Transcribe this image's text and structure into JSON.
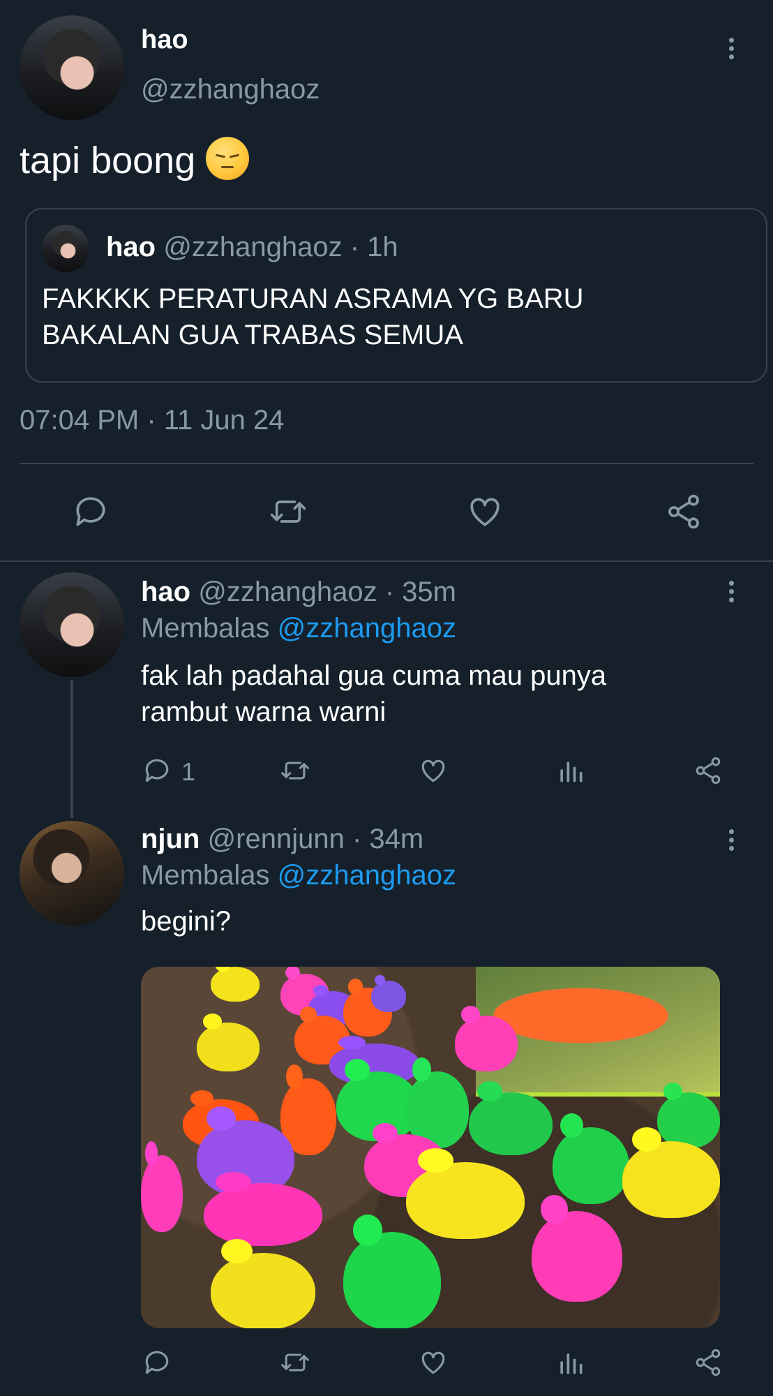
{
  "main_tweet": {
    "display_name": "hao",
    "handle": "@zzhanghaoz",
    "text": "tapi boong",
    "emoji": "pensive-face",
    "timestamp": "07:04 PM · 11 Jun 24"
  },
  "quoted_tweet": {
    "display_name": "hao",
    "handle": "@zzhanghaoz",
    "time": "· 1h",
    "text_line1": "FAKKKK PERATURAN ASRAMA YG BARU",
    "text_line2": "BAKALAN GUA TRABAS SEMUA"
  },
  "replies": [
    {
      "display_name": "hao",
      "handle": "@zzhanghaoz",
      "time": "· 35m",
      "replying_label": "Membalas",
      "replying_to": "@zzhanghaoz",
      "text_line1": "fak lah padahal gua cuma mau punya",
      "text_line2": "rambut warna warni",
      "reply_count": "1"
    },
    {
      "display_name": "njun",
      "handle": "@rennjunn",
      "time": "· 34m",
      "replying_label": "Membalas",
      "replying_to": "@zzhanghaoz",
      "text": "begini?",
      "reply_count": ""
    }
  ],
  "colors": {
    "background": "#15202b",
    "muted": "#8899a6",
    "link": "#1d9bf0",
    "divider": "#38444d"
  },
  "icons": [
    "reply-icon",
    "retweet-icon",
    "like-icon",
    "share-icon",
    "analytics-icon",
    "more-icon"
  ]
}
